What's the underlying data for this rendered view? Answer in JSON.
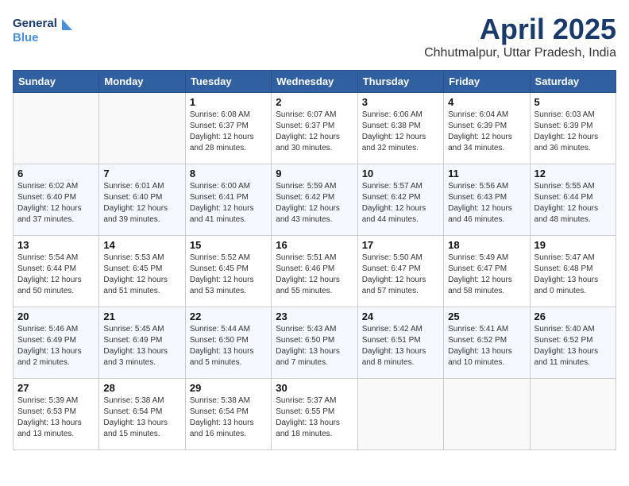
{
  "header": {
    "logo_line1": "General",
    "logo_line2": "Blue",
    "month": "April 2025",
    "location": "Chhutmalpur, Uttar Pradesh, India"
  },
  "columns": [
    "Sunday",
    "Monday",
    "Tuesday",
    "Wednesday",
    "Thursday",
    "Friday",
    "Saturday"
  ],
  "weeks": [
    [
      {
        "day": "",
        "sunrise": "",
        "sunset": "",
        "daylight": ""
      },
      {
        "day": "",
        "sunrise": "",
        "sunset": "",
        "daylight": ""
      },
      {
        "day": "1",
        "sunrise": "Sunrise: 6:08 AM",
        "sunset": "Sunset: 6:37 PM",
        "daylight": "Daylight: 12 hours and 28 minutes."
      },
      {
        "day": "2",
        "sunrise": "Sunrise: 6:07 AM",
        "sunset": "Sunset: 6:37 PM",
        "daylight": "Daylight: 12 hours and 30 minutes."
      },
      {
        "day": "3",
        "sunrise": "Sunrise: 6:06 AM",
        "sunset": "Sunset: 6:38 PM",
        "daylight": "Daylight: 12 hours and 32 minutes."
      },
      {
        "day": "4",
        "sunrise": "Sunrise: 6:04 AM",
        "sunset": "Sunset: 6:39 PM",
        "daylight": "Daylight: 12 hours and 34 minutes."
      },
      {
        "day": "5",
        "sunrise": "Sunrise: 6:03 AM",
        "sunset": "Sunset: 6:39 PM",
        "daylight": "Daylight: 12 hours and 36 minutes."
      }
    ],
    [
      {
        "day": "6",
        "sunrise": "Sunrise: 6:02 AM",
        "sunset": "Sunset: 6:40 PM",
        "daylight": "Daylight: 12 hours and 37 minutes."
      },
      {
        "day": "7",
        "sunrise": "Sunrise: 6:01 AM",
        "sunset": "Sunset: 6:40 PM",
        "daylight": "Daylight: 12 hours and 39 minutes."
      },
      {
        "day": "8",
        "sunrise": "Sunrise: 6:00 AM",
        "sunset": "Sunset: 6:41 PM",
        "daylight": "Daylight: 12 hours and 41 minutes."
      },
      {
        "day": "9",
        "sunrise": "Sunrise: 5:59 AM",
        "sunset": "Sunset: 6:42 PM",
        "daylight": "Daylight: 12 hours and 43 minutes."
      },
      {
        "day": "10",
        "sunrise": "Sunrise: 5:57 AM",
        "sunset": "Sunset: 6:42 PM",
        "daylight": "Daylight: 12 hours and 44 minutes."
      },
      {
        "day": "11",
        "sunrise": "Sunrise: 5:56 AM",
        "sunset": "Sunset: 6:43 PM",
        "daylight": "Daylight: 12 hours and 46 minutes."
      },
      {
        "day": "12",
        "sunrise": "Sunrise: 5:55 AM",
        "sunset": "Sunset: 6:44 PM",
        "daylight": "Daylight: 12 hours and 48 minutes."
      }
    ],
    [
      {
        "day": "13",
        "sunrise": "Sunrise: 5:54 AM",
        "sunset": "Sunset: 6:44 PM",
        "daylight": "Daylight: 12 hours and 50 minutes."
      },
      {
        "day": "14",
        "sunrise": "Sunrise: 5:53 AM",
        "sunset": "Sunset: 6:45 PM",
        "daylight": "Daylight: 12 hours and 51 minutes."
      },
      {
        "day": "15",
        "sunrise": "Sunrise: 5:52 AM",
        "sunset": "Sunset: 6:45 PM",
        "daylight": "Daylight: 12 hours and 53 minutes."
      },
      {
        "day": "16",
        "sunrise": "Sunrise: 5:51 AM",
        "sunset": "Sunset: 6:46 PM",
        "daylight": "Daylight: 12 hours and 55 minutes."
      },
      {
        "day": "17",
        "sunrise": "Sunrise: 5:50 AM",
        "sunset": "Sunset: 6:47 PM",
        "daylight": "Daylight: 12 hours and 57 minutes."
      },
      {
        "day": "18",
        "sunrise": "Sunrise: 5:49 AM",
        "sunset": "Sunset: 6:47 PM",
        "daylight": "Daylight: 12 hours and 58 minutes."
      },
      {
        "day": "19",
        "sunrise": "Sunrise: 5:47 AM",
        "sunset": "Sunset: 6:48 PM",
        "daylight": "Daylight: 13 hours and 0 minutes."
      }
    ],
    [
      {
        "day": "20",
        "sunrise": "Sunrise: 5:46 AM",
        "sunset": "Sunset: 6:49 PM",
        "daylight": "Daylight: 13 hours and 2 minutes."
      },
      {
        "day": "21",
        "sunrise": "Sunrise: 5:45 AM",
        "sunset": "Sunset: 6:49 PM",
        "daylight": "Daylight: 13 hours and 3 minutes."
      },
      {
        "day": "22",
        "sunrise": "Sunrise: 5:44 AM",
        "sunset": "Sunset: 6:50 PM",
        "daylight": "Daylight: 13 hours and 5 minutes."
      },
      {
        "day": "23",
        "sunrise": "Sunrise: 5:43 AM",
        "sunset": "Sunset: 6:50 PM",
        "daylight": "Daylight: 13 hours and 7 minutes."
      },
      {
        "day": "24",
        "sunrise": "Sunrise: 5:42 AM",
        "sunset": "Sunset: 6:51 PM",
        "daylight": "Daylight: 13 hours and 8 minutes."
      },
      {
        "day": "25",
        "sunrise": "Sunrise: 5:41 AM",
        "sunset": "Sunset: 6:52 PM",
        "daylight": "Daylight: 13 hours and 10 minutes."
      },
      {
        "day": "26",
        "sunrise": "Sunrise: 5:40 AM",
        "sunset": "Sunset: 6:52 PM",
        "daylight": "Daylight: 13 hours and 11 minutes."
      }
    ],
    [
      {
        "day": "27",
        "sunrise": "Sunrise: 5:39 AM",
        "sunset": "Sunset: 6:53 PM",
        "daylight": "Daylight: 13 hours and 13 minutes."
      },
      {
        "day": "28",
        "sunrise": "Sunrise: 5:38 AM",
        "sunset": "Sunset: 6:54 PM",
        "daylight": "Daylight: 13 hours and 15 minutes."
      },
      {
        "day": "29",
        "sunrise": "Sunrise: 5:38 AM",
        "sunset": "Sunset: 6:54 PM",
        "daylight": "Daylight: 13 hours and 16 minutes."
      },
      {
        "day": "30",
        "sunrise": "Sunrise: 5:37 AM",
        "sunset": "Sunset: 6:55 PM",
        "daylight": "Daylight: 13 hours and 18 minutes."
      },
      {
        "day": "",
        "sunrise": "",
        "sunset": "",
        "daylight": ""
      },
      {
        "day": "",
        "sunrise": "",
        "sunset": "",
        "daylight": ""
      },
      {
        "day": "",
        "sunrise": "",
        "sunset": "",
        "daylight": ""
      }
    ]
  ]
}
